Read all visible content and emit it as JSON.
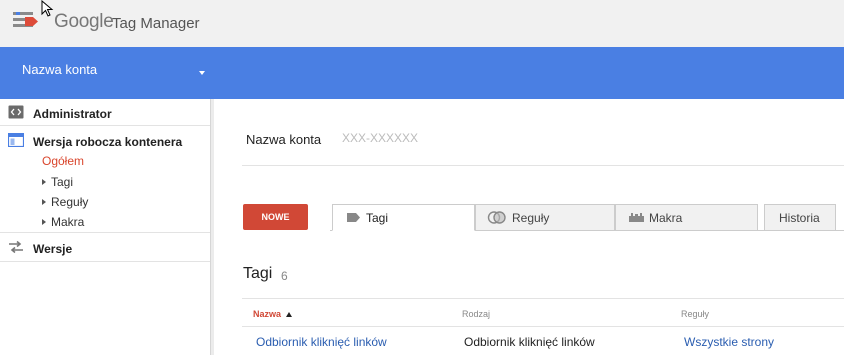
{
  "header": {
    "brand_google": "Google",
    "brand_product": "Tag Manager"
  },
  "account_bar": {
    "account_name": "Nazwa konta"
  },
  "sidebar": {
    "admin_label": "Administrator",
    "draft_label": "Wersja robocza kontenera",
    "draft_items": [
      {
        "label": "Ogółem",
        "active": true
      },
      {
        "label": "Tagi",
        "active": false
      },
      {
        "label": "Reguły",
        "active": false
      },
      {
        "label": "Makra",
        "active": false
      }
    ],
    "versions_label": "Wersje"
  },
  "container": {
    "name": "Nazwa konta",
    "id": "XXX-XXXXXX"
  },
  "actions": {
    "new_button": "NOWE"
  },
  "tabs": [
    {
      "label": "Tagi",
      "icon": "tag-icon",
      "active": true
    },
    {
      "label": "Reguły",
      "icon": "rules-icon",
      "active": false
    },
    {
      "label": "Makra",
      "icon": "macro-icon",
      "active": false
    },
    {
      "label": "Historia",
      "icon": "",
      "active": false
    }
  ],
  "section": {
    "title": "Tagi",
    "count": "6"
  },
  "table": {
    "columns": [
      {
        "label": "Nazwa",
        "sorted": true
      },
      {
        "label": "Rodzaj",
        "sorted": false
      },
      {
        "label": "Reguły",
        "sorted": false
      }
    ],
    "rows": [
      {
        "name": "Odbiornik kliknięć linków",
        "type": "Odbiornik kliknięć linków",
        "rules": "Wszystkie strony"
      }
    ]
  },
  "colors": {
    "account_bar": "#4a7fe3",
    "new_button": "#d14836",
    "active_nav": "#d9452c",
    "link": "#2a5db0"
  }
}
